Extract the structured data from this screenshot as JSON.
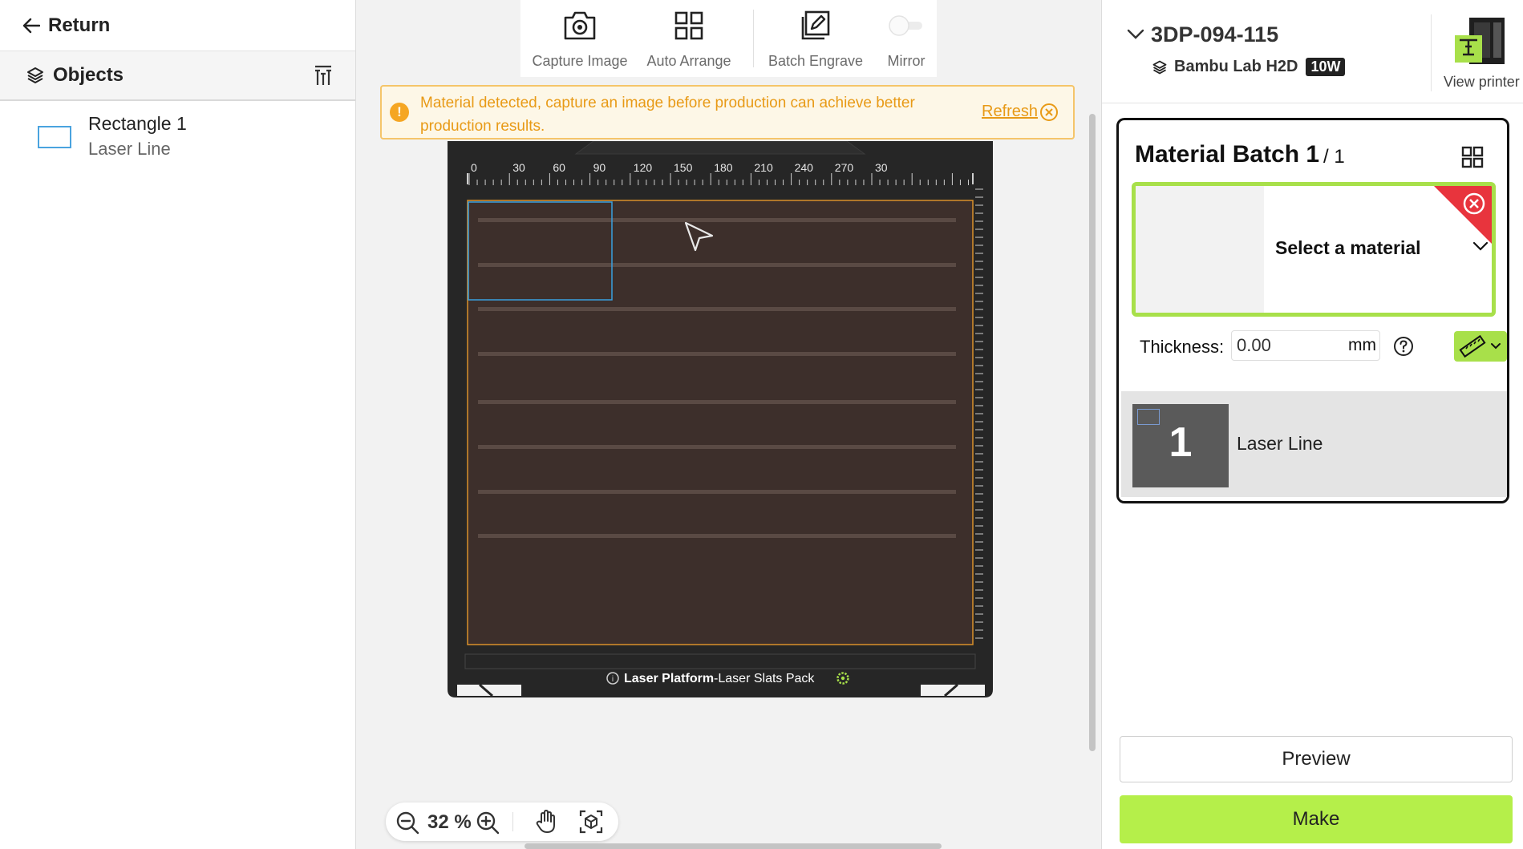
{
  "left_panel": {
    "return_label": "Return",
    "objects_title": "Objects",
    "objects": [
      {
        "name": "Rectangle 1",
        "type": "Laser Line"
      }
    ]
  },
  "toolbar": {
    "capture_label": "Capture Image",
    "auto_arrange_label": "Auto Arrange",
    "batch_engrave_label": "Batch Engrave",
    "mirror_label": "Mirror",
    "mirror_on": false
  },
  "alert": {
    "icon": "info-icon",
    "message": "Material detected, capture an image before production can achieve better production results.",
    "refresh_label": "Refresh"
  },
  "canvas": {
    "ruler_ticks": [
      "0",
      "30",
      "60",
      "90",
      "120",
      "150",
      "180",
      "210",
      "240",
      "270",
      "30"
    ],
    "platform_name": "Laser Platform",
    "platform_pack": "-Laser Slats Pack",
    "zoom_value": "32 %",
    "bed_color": "#3d2f2b",
    "frame_color": "#262626"
  },
  "right_panel": {
    "device_name": "3DP-094-115",
    "printer_model": "Bambu Lab H2D",
    "laser_power": "10W",
    "view_printer_label": "View printer",
    "batch": {
      "title": "Material Batch 1",
      "total": "/ 1",
      "material_placeholder": "Select a material",
      "thickness_label": "Thickness:",
      "thickness_value": "0.00",
      "thickness_unit": "mm",
      "jobs": [
        {
          "number": "1",
          "label": "Laser Line"
        }
      ]
    },
    "preview_label": "Preview",
    "make_label": "Make",
    "accent_color": "#b5ef4a"
  }
}
